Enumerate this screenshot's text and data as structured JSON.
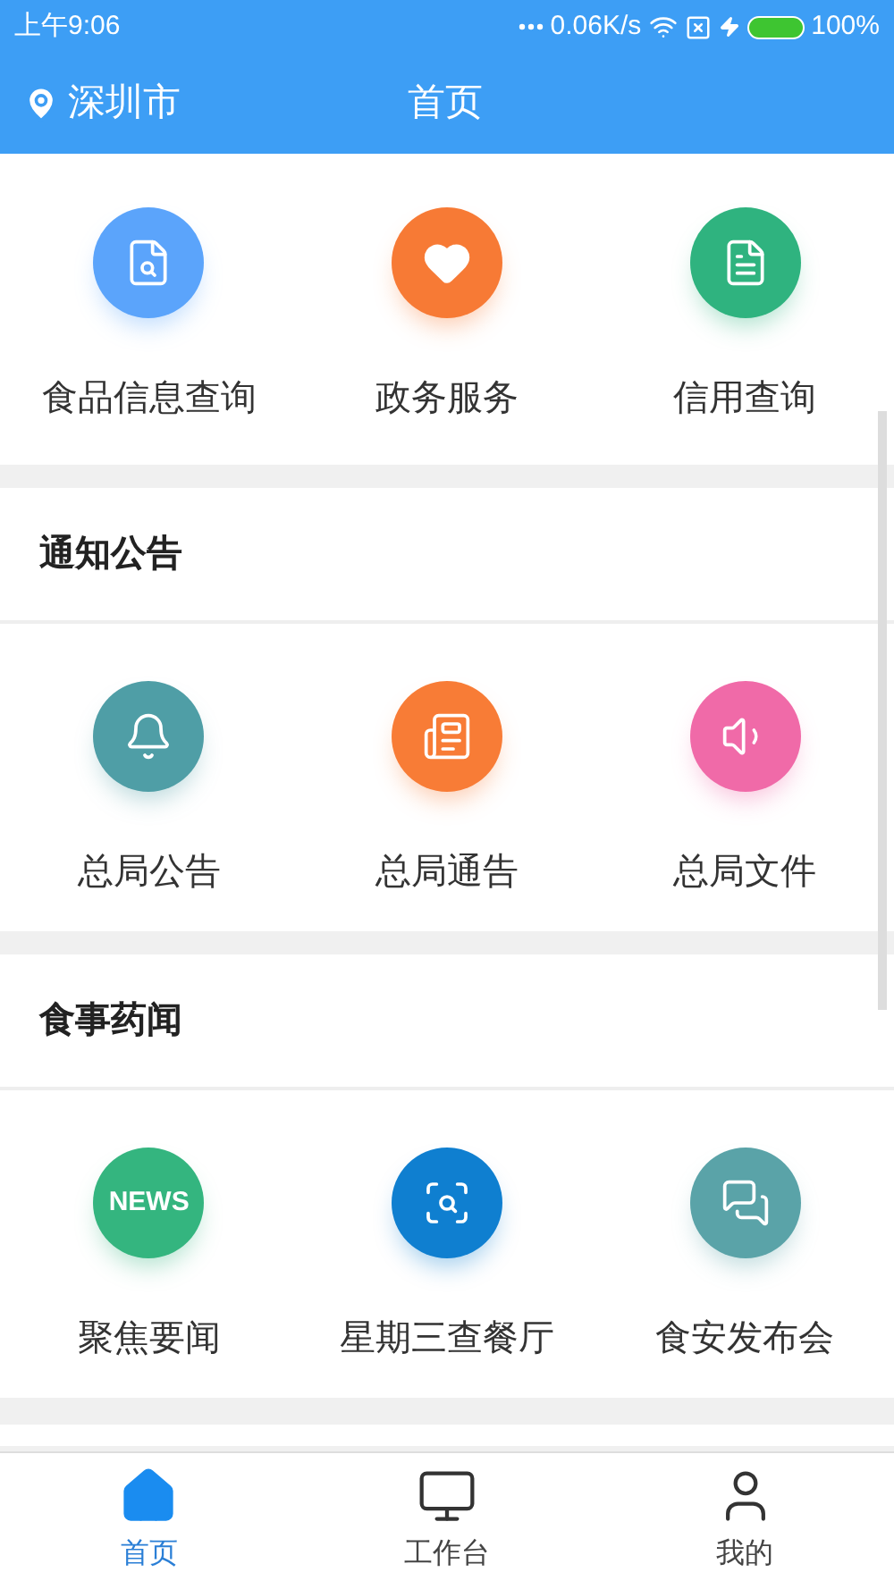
{
  "status_bar": {
    "time": "上午9:06",
    "speed": "0.06K/s",
    "battery": "100%"
  },
  "header": {
    "location": "深圳市",
    "title": "首页"
  },
  "sections": [
    {
      "items": [
        {
          "label": "食品信息查询",
          "color": "#5ba4fb",
          "kind": "doc-search"
        },
        {
          "label": "政务服务",
          "color": "#f77a35",
          "kind": "heart"
        },
        {
          "label": "信用查询",
          "color": "#2fb37f",
          "kind": "note-search"
        }
      ]
    },
    {
      "title": "通知公告",
      "items": [
        {
          "label": "总局公告",
          "color": "#4f9ea6",
          "kind": "bell"
        },
        {
          "label": "总局通告",
          "color": "#f87c36",
          "kind": "pages"
        },
        {
          "label": "总局文件",
          "color": "#f06aa8",
          "kind": "speaker"
        }
      ]
    },
    {
      "title": "食事药闻",
      "items": [
        {
          "label": "聚焦要闻",
          "color": "#34b57f",
          "kind": "text",
          "icon_text": "NEWS"
        },
        {
          "label": "星期三查餐厅",
          "color": "#0f7fd0",
          "kind": "inspect"
        },
        {
          "label": "食安发布会",
          "color": "#5aa3a8",
          "kind": "chat"
        }
      ]
    }
  ],
  "tabs": [
    {
      "label": "首页",
      "kind": "home",
      "selected": true
    },
    {
      "label": "工作台",
      "kind": "monitor",
      "selected": false
    },
    {
      "label": "我的",
      "kind": "user",
      "selected": false
    }
  ]
}
